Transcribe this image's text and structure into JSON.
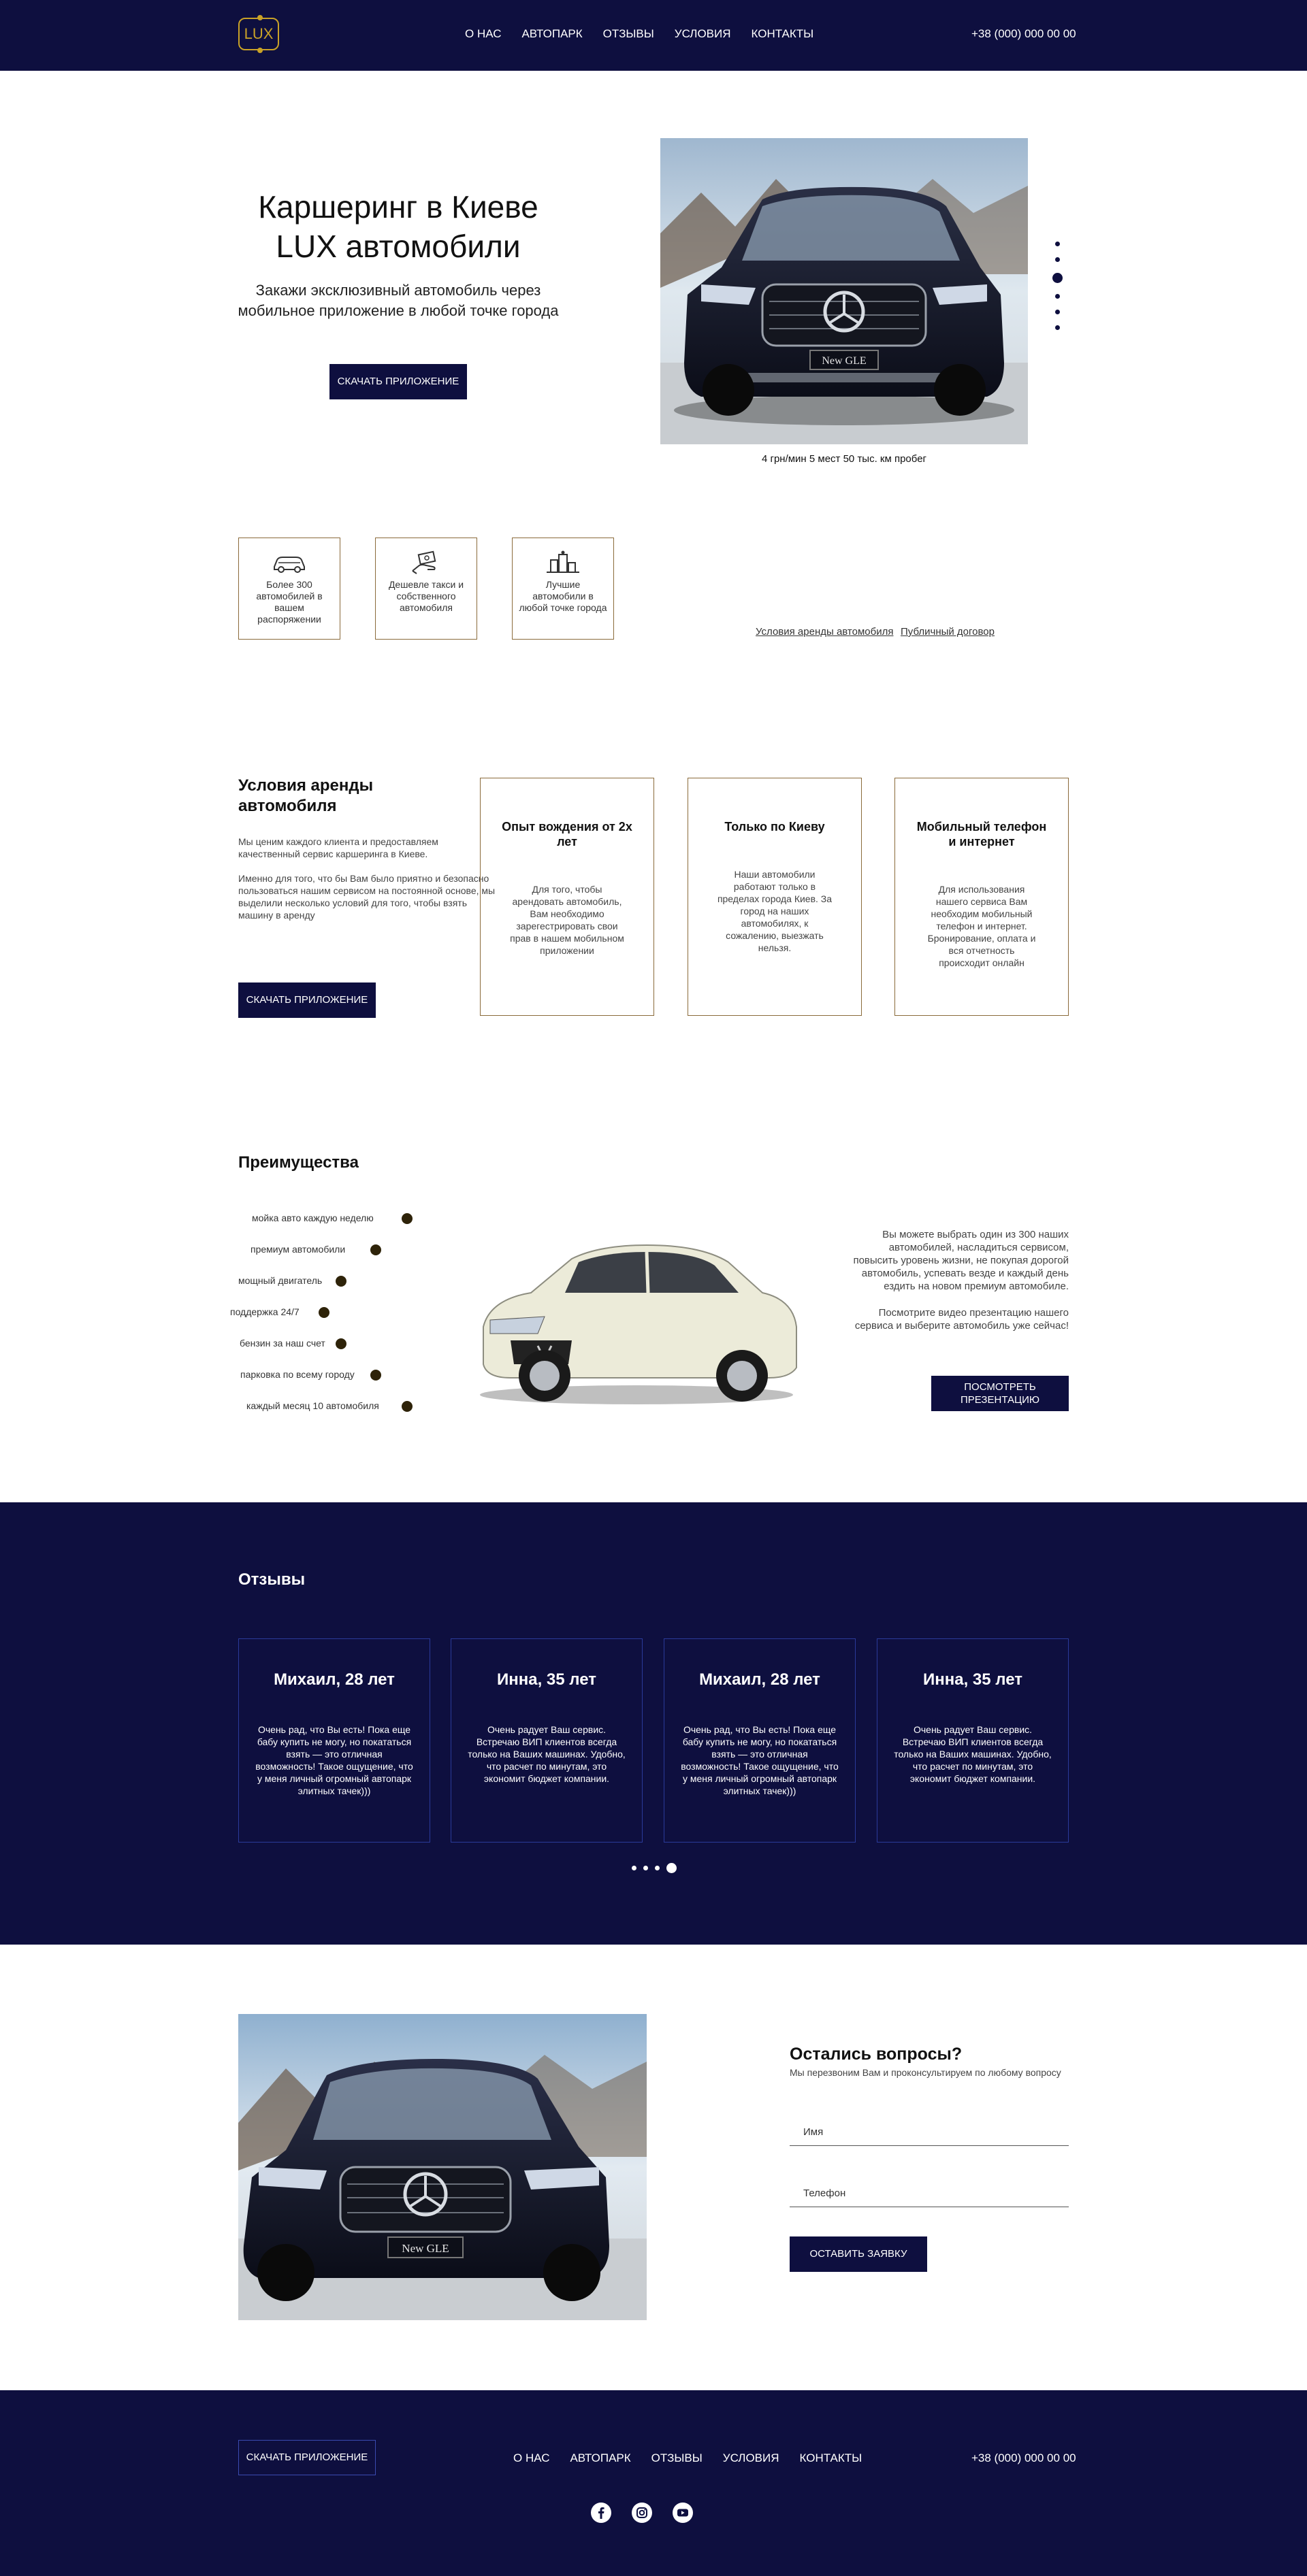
{
  "header": {
    "logo_text": "LUX",
    "nav": [
      "О НАС",
      "АВТОПАРК",
      "ОТЗЫВЫ",
      "УСЛОВИЯ",
      "КОНТАКТЫ"
    ],
    "phone": "+38 (000) 000 00 00"
  },
  "hero": {
    "title_line1": "Каршеринг в Киеве",
    "title_line2": "LUX автомобили",
    "subtitle_line1": "Закажи эксклюзивный автомобиль через",
    "subtitle_line2": "мобильное приложение в любой точке города",
    "button": "СКАЧАТЬ ПРИЛОЖЕНИЕ",
    "car_plate": "New GLE",
    "caption": "4 грн/мин 5 мест 50 тыс. км пробег",
    "slider_count": 6,
    "slider_active": 3
  },
  "features": [
    {
      "icon": "car-icon",
      "text": "Более 300 автомобилей в вашем распоряжении"
    },
    {
      "icon": "hand-money-icon",
      "text": "Дешевле такси и собственного автомобиля"
    },
    {
      "icon": "city-icon",
      "text": "Лучшие автомобили в любой точке города"
    }
  ],
  "links": {
    "rental_terms": "Условия аренды автомобиля",
    "public_contract": "Публичный договор"
  },
  "conditions": {
    "title_line1": "Условия аренды",
    "title_line2": "автомобиля",
    "para1": "Мы ценим каждого клиента и предоставляем качественный сервис каршеринга в Киеве.",
    "para2": "Именно для того, что бы Вам было приятно и безопасно пользоваться нашим сервисом на постоянной основе, мы выделили несколько условий для того, чтобы взять машину в аренду",
    "button": "СКАЧАТЬ ПРИЛОЖЕНИЕ",
    "cards": [
      {
        "title": "Опыт вождения от 2х лет",
        "text": "Для того, чтобы арендовать автомобиль, Вам необходимо зарегестрировать свои прав в нашем мобильном приложении"
      },
      {
        "title": "Только по Киеву",
        "text": "Наши автомобили работают только в пределах города Киев. За город на наших автомобилях, к сожалению, выезжать нельзя."
      },
      {
        "title": "Мобильный телефон и интернет",
        "text": "Для использования нашего сервиса Вам необходим мобильный телефон и интернет. Бронирование, оплата и вся отчетность происходит онлайн"
      }
    ]
  },
  "advantages": {
    "title": "Преимущества",
    "items": [
      "мойка авто каждую неделю",
      "премиум автомобили",
      "мощный двигатель",
      "поддержка 24/7",
      "бензин за наш счет",
      "парковка по всему городу",
      "каждый месяц 10 автомобиля"
    ],
    "text1": "Вы можете выбрать один из 300 наших автомобилей, насладиться сервисом, повысить уровень жизни, не покупая дорогой автомобиль, успевать везде и каждый день ездить на новом премиум автомобиле.",
    "text2": "Посмотрите видео презентацию нашего сервиса и выберите автомобиль уже сейчас!",
    "button_line1": "ПОСМОТРЕТЬ",
    "button_line2": "ПРЕЗЕНТАЦИЮ"
  },
  "reviews": {
    "title": "Отзывы",
    "items": [
      {
        "name": "Михаил, 28 лет",
        "text": "Очень рад, что Вы есть! Пока еще бабу купить не могу, но покататься взять — это отличная возможность! Такое ощущение, что у меня личный огромный автопарк элитных тачек)))"
      },
      {
        "name": "Инна, 35 лет",
        "text": "Очень радует Ваш сервис. Встречаю ВИП клиентов всегда только на Ваших машинах. Удобно, что расчет по минутам, это экономит бюджет компании."
      },
      {
        "name": "Михаил, 28 лет",
        "text": "Очень рад, что Вы есть! Пока еще бабу купить не могу, но покататься взять — это отличная возможность! Такое ощущение, что у меня личный огромный автопарк элитных тачек)))"
      },
      {
        "name": "Инна, 35 лет",
        "text": "Очень радует Ваш сервис. Встречаю ВИП клиентов всегда только на Ваших машинах. Удобно, что расчет по минутам, это экономит бюджет компании."
      }
    ],
    "dots_count": 4,
    "dots_active": 4
  },
  "contact": {
    "title": "Остались вопросы?",
    "subtitle": "Мы перезвоним Вам и проконсультируем по любому вопросу",
    "name_placeholder": "Имя",
    "phone_placeholder": "Телефон",
    "button": "ОСТАВИТЬ ЗАЯВКУ",
    "car_plate": "New GLE"
  },
  "footer": {
    "button": "СКАЧАТЬ ПРИЛОЖЕНИЕ",
    "nav": [
      "О НАС",
      "АВТОПАРК",
      "ОТЗЫВЫ",
      "УСЛОВИЯ",
      "КОНТАКТЫ"
    ],
    "phone": "+38 (000) 000 00 00",
    "socials": [
      "facebook-icon",
      "instagram-icon",
      "youtube-icon"
    ]
  },
  "colors": {
    "navy": "#0e0f3f",
    "gold": "#c9a227",
    "border_brown": "#8a6a3a",
    "bullet": "#2e2309"
  }
}
